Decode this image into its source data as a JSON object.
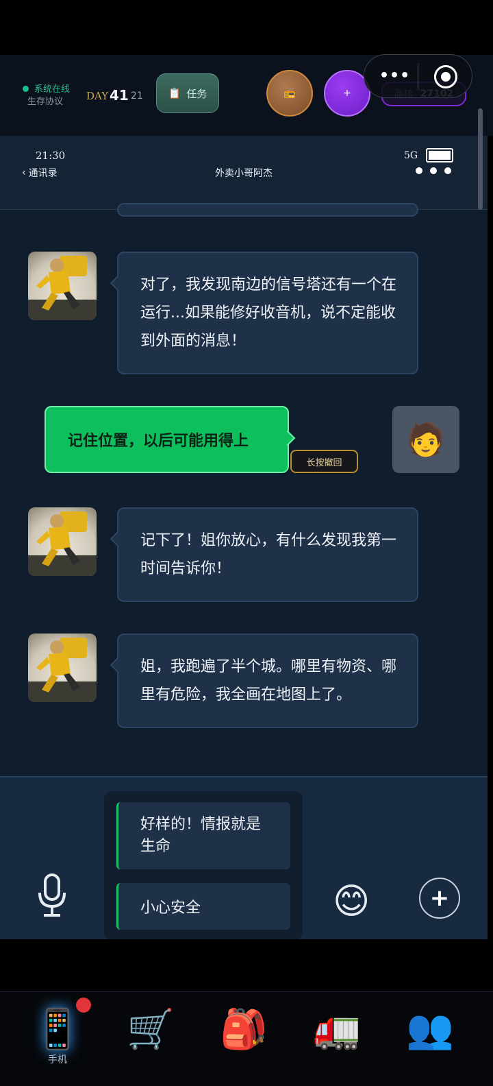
{
  "status_bar": {
    "online_text": "系统在线",
    "protocol_text": "生存协议",
    "day_label": "DAY",
    "day_number": "41",
    "day_sub": "21",
    "task_label": "任务",
    "crystal_label": "晶核",
    "crystal_value": "27102",
    "purple_button_label": "+"
  },
  "phone": {
    "time": "21:30",
    "signal": "5G",
    "back_label": "通讯录",
    "title": "外卖小哥阿杰"
  },
  "messages": [
    {
      "from": "contact",
      "text": "对了，我发现南边的信号塔还有一个在运行...如果能修好收音机，说不定能收到外面的消息！"
    },
    {
      "from": "me",
      "text": "记住位置，以后可能用得上",
      "undo_label": "长按撤回"
    },
    {
      "from": "contact",
      "text": "记下了！姐你放心，有什么发现我第一时间告诉你！"
    },
    {
      "from": "contact",
      "text": "姐，我跑遍了半个城。哪里有物资、哪里有危险，我全画在地图上了。"
    }
  ],
  "quick_replies": [
    "好样的！情报就是生命",
    "小心安全"
  ],
  "bottom_nav": [
    {
      "icon": "phone-icon",
      "label": "手机",
      "active": true,
      "has_badge": true
    },
    {
      "icon": "cart-icon",
      "label": ""
    },
    {
      "icon": "backpack-icon",
      "label": ""
    },
    {
      "icon": "truck-icon",
      "label": ""
    },
    {
      "icon": "people-icon",
      "label": ""
    }
  ],
  "colors": {
    "accent_green": "#0ec05d",
    "bubble_in": "#1f3149",
    "badge_red": "#e2343b",
    "crystal_purple": "#7a2bd6"
  }
}
